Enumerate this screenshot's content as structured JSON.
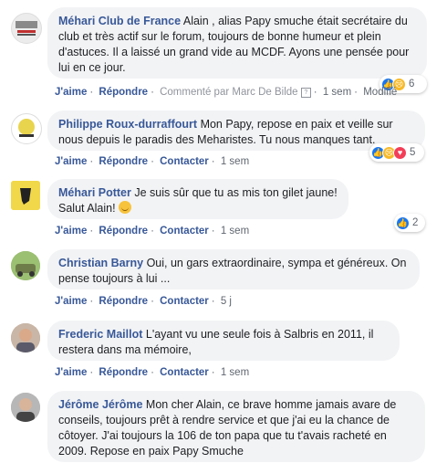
{
  "comments": [
    {
      "author": "Méhari Club de France",
      "text": "Alain , alias Papy smuche était secrétaire du club et très actif sur le forum, toujours de bonne humeur et plein d'astuces. Il a laissé un grand vide au MCDF. Ayons une pensée pour lui en ce jour.",
      "like": "J'aime",
      "reply": "Répondre",
      "commented_by": "Commenté par Marc De Bilde",
      "time": "1 sem",
      "extra": "Modifié",
      "reactions_count": "6"
    },
    {
      "author": "Philippe Roux-durraffourt",
      "text": "Mon Papy, repose en paix et veille sur nous depuis le paradis des Meharistes. Tu nous manques tant.",
      "like": "J'aime",
      "reply": "Répondre",
      "contact": "Contacter",
      "time": "1 sem",
      "reactions_count": "5"
    },
    {
      "author": "Méhari Potter",
      "text": "Je suis sûr que tu as mis ton gilet jaune! Salut Alain!",
      "like": "J'aime",
      "reply": "Répondre",
      "contact": "Contacter",
      "time": "1 sem",
      "reactions_count": "2"
    },
    {
      "author": "Christian Barny",
      "text": "Oui, un gars extraordinaire, sympa et généreux. On pense toujours à lui ...",
      "like": "J'aime",
      "reply": "Répondre",
      "contact": "Contacter",
      "time": "5 j"
    },
    {
      "author": "Frederic Maillot",
      "text": "L'ayant vu une seule fois à Salbris en 2011, il restera dans ma mémoire,",
      "like": "J'aime",
      "reply": "Répondre",
      "contact": "Contacter",
      "time": "1 sem"
    },
    {
      "author": "Jérôme Jérôme",
      "text": "Mon cher Alain, ce brave homme jamais avare de conseils, toujours prêt à rendre service et que j'ai eu la chance de côtoyer. J'ai toujours la 106 de ton papa que tu t'avais racheté en 2009. Repose en paix Papy Smuche"
    }
  ],
  "icons": {
    "reaction_like": "thumbs-up-icon",
    "reaction_sad": "sad-face-icon",
    "reaction_love": "heart-icon",
    "smile_emoji": "smile-emoji-icon"
  },
  "colors": {
    "author": "#385898",
    "bubble": "#f2f3f5",
    "meta": "#606770",
    "like": "#1877f2",
    "sad": "#f7b928",
    "love": "#f33e58"
  }
}
